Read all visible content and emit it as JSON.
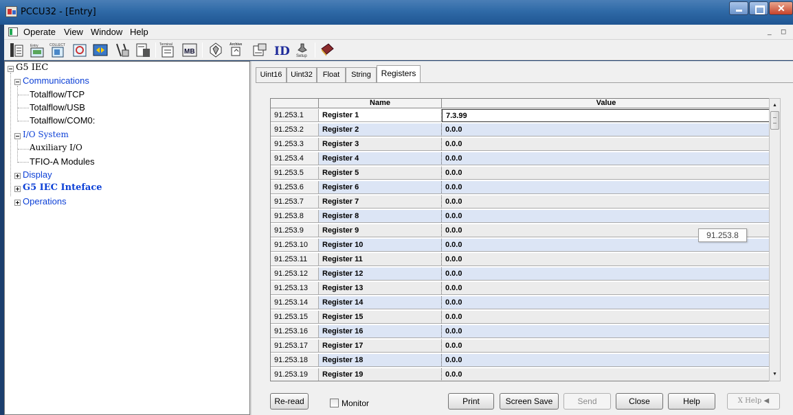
{
  "window": {
    "title": "PCCU32 - [Entry]"
  },
  "menu": {
    "items": [
      "Operate",
      "View",
      "Window",
      "Help"
    ]
  },
  "toolbar": {
    "buttons": [
      {
        "icon": "entry-icon",
        "label": "Entry"
      },
      {
        "icon": "collect-icon",
        "label": "Collect"
      },
      {
        "icon": "calibrate-icon",
        "label": ""
      },
      {
        "icon": "trend-icon",
        "label": ""
      },
      {
        "icon": "refresh-icon",
        "label": ""
      },
      {
        "icon": "tools-icon",
        "label": ""
      },
      {
        "icon": "report-icon",
        "label": ""
      },
      {
        "icon": "terminal-icon",
        "label": "Terminal"
      },
      {
        "icon": "modbus-icon",
        "label": "MB"
      },
      {
        "icon": "gear-icon",
        "label": ""
      },
      {
        "icon": "archive-icon",
        "label": "Archive"
      },
      {
        "icon": "export-icon",
        "label": ""
      },
      {
        "icon": "id-icon",
        "label": "ID"
      },
      {
        "icon": "setup-icon",
        "label": "Setup"
      },
      {
        "icon": "book-icon",
        "label": ""
      }
    ]
  },
  "tree": {
    "root": "G5 IEC",
    "communications": "Communications",
    "totalflow_tcp": "Totalflow/TCP",
    "totalflow_usb": "Totalflow/USB",
    "totalflow_com0": "Totalflow/COM0:",
    "io_system": "I/O System",
    "auxiliary_io": "Auxiliary I/O",
    "tfio_modules": "TFIO-A Modules",
    "display": "Display",
    "g5_iec_interface": "G5 IEC Inteface",
    "operations": "Operations"
  },
  "tabs": [
    "Uint16",
    "Uint32",
    "Float",
    "String",
    "Registers"
  ],
  "grid": {
    "headers": {
      "name": "Name",
      "value": "Value"
    },
    "rows": [
      {
        "id": "91.253.1",
        "name": "Register 1",
        "value": "7.3.99"
      },
      {
        "id": "91.253.2",
        "name": "Register 2",
        "value": "0.0.0"
      },
      {
        "id": "91.253.3",
        "name": "Register 3",
        "value": "0.0.0"
      },
      {
        "id": "91.253.4",
        "name": "Register 4",
        "value": "0.0.0"
      },
      {
        "id": "91.253.5",
        "name": "Register 5",
        "value": "0.0.0"
      },
      {
        "id": "91.253.6",
        "name": "Register 6",
        "value": "0.0.0"
      },
      {
        "id": "91.253.7",
        "name": "Register 7",
        "value": "0.0.0"
      },
      {
        "id": "91.253.8",
        "name": "Register 8",
        "value": "0.0.0"
      },
      {
        "id": "91.253.9",
        "name": "Register 9",
        "value": "0.0.0"
      },
      {
        "id": "91.253.10",
        "name": "Register 10",
        "value": "0.0.0"
      },
      {
        "id": "91.253.11",
        "name": "Register 11",
        "value": "0.0.0"
      },
      {
        "id": "91.253.12",
        "name": "Register 12",
        "value": "0.0.0"
      },
      {
        "id": "91.253.13",
        "name": "Register 13",
        "value": "0.0.0"
      },
      {
        "id": "91.253.14",
        "name": "Register 14",
        "value": "0.0.0"
      },
      {
        "id": "91.253.15",
        "name": "Register 15",
        "value": "0.0.0"
      },
      {
        "id": "91.253.16",
        "name": "Register 16",
        "value": "0.0.0"
      },
      {
        "id": "91.253.17",
        "name": "Register 17",
        "value": "0.0.0"
      },
      {
        "id": "91.253.18",
        "name": "Register 18",
        "value": "0.0.0"
      },
      {
        "id": "91.253.19",
        "name": "Register 19",
        "value": "0.0.0"
      }
    ]
  },
  "tooltip": "91.253.8",
  "buttons": {
    "reread": "Re-read",
    "monitor": "Monitor",
    "print": "Print",
    "screen_save": "Screen Save",
    "send": "Send",
    "close": "Close",
    "help": "Help",
    "xhelp": "X Help"
  },
  "colors": {
    "title_bar": "#2f6aa7",
    "tree_link": "#0b3fd6",
    "row_alt": "#dce5f5"
  }
}
